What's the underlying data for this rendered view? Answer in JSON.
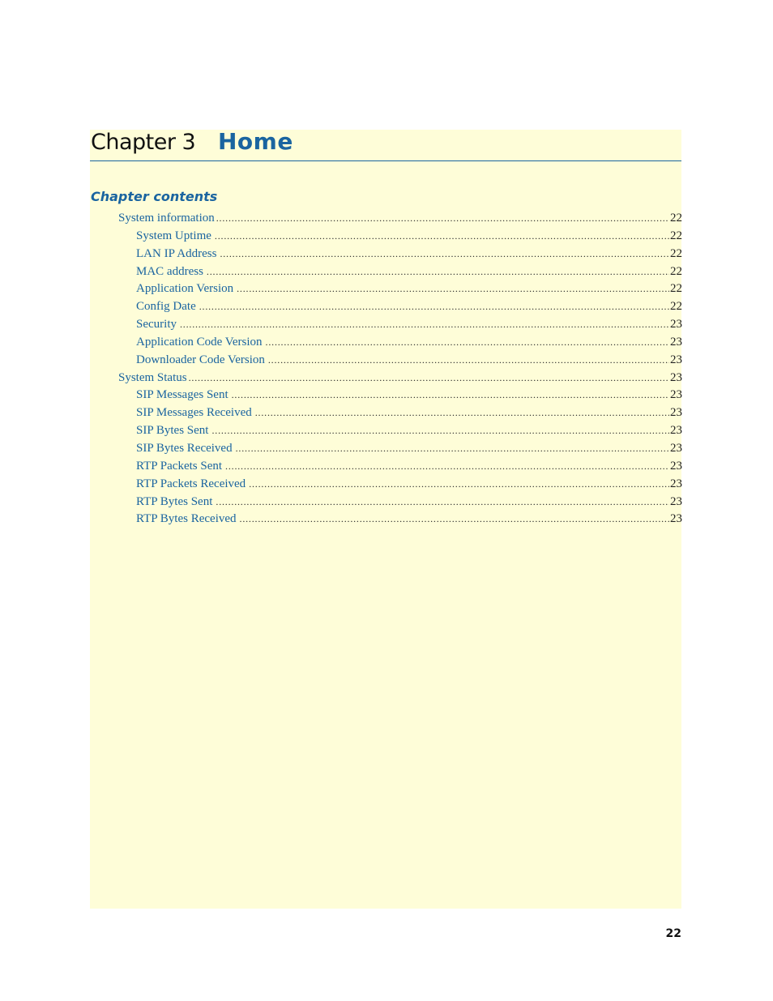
{
  "chapter": {
    "label": "Chapter 3",
    "title": "Home"
  },
  "contents_heading": "Chapter contents",
  "toc": [
    {
      "label": "System information",
      "page": "22",
      "level": 1
    },
    {
      "label": "System Uptime",
      "page": "22",
      "level": 2
    },
    {
      "label": "LAN IP Address",
      "page": "22",
      "level": 2
    },
    {
      "label": "MAC address",
      "page": "22",
      "level": 2
    },
    {
      "label": "Application Version",
      "page": "22",
      "level": 2
    },
    {
      "label": "Config Date",
      "page": "22",
      "level": 2
    },
    {
      "label": "Security",
      "page": "23",
      "level": 2
    },
    {
      "label": "Application Code Version",
      "page": "23",
      "level": 2
    },
    {
      "label": "Downloader Code Version",
      "page": "23",
      "level": 2
    },
    {
      "label": "System Status",
      "page": "23",
      "level": 1
    },
    {
      "label": "SIP Messages Sent",
      "page": "23",
      "level": 2
    },
    {
      "label": "SIP Messages Received",
      "page": "23",
      "level": 2
    },
    {
      "label": "SIP Bytes Sent",
      "page": "23",
      "level": 2
    },
    {
      "label": "SIP Bytes Received",
      "page": "23",
      "level": 2
    },
    {
      "label": "RTP Packets Sent",
      "page": "23",
      "level": 2
    },
    {
      "label": "RTP Packets Received",
      "page": "23",
      "level": 2
    },
    {
      "label": "RTP Bytes Sent",
      "page": "23",
      "level": 2
    },
    {
      "label": "RTP Bytes Received",
      "page": "23",
      "level": 2
    }
  ],
  "page_number": "22",
  "colors": {
    "accent": "#1a64a0",
    "panel_background": "#fefdd8"
  }
}
